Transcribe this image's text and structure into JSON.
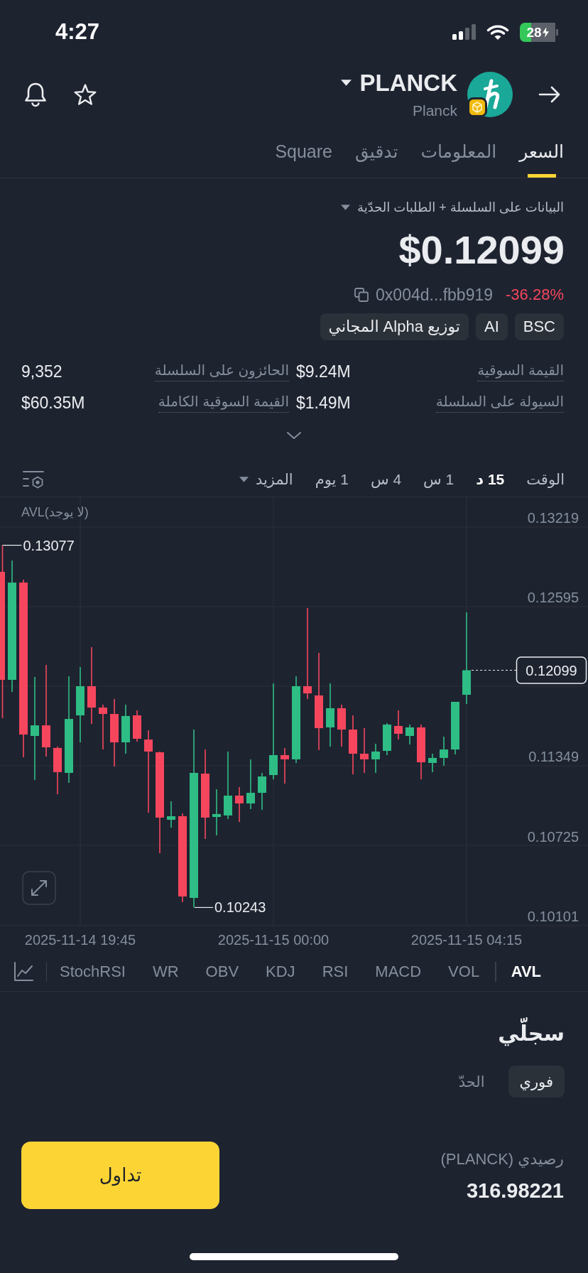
{
  "status_bar": {
    "time": "4:27",
    "battery": "28"
  },
  "header": {
    "symbol": "PLANCK",
    "name": "Planck"
  },
  "tabs": [
    {
      "label": "السعر",
      "selected": true
    },
    {
      "label": "المعلومات",
      "selected": false
    },
    {
      "label": "تدقيق",
      "selected": false
    },
    {
      "label": "Square",
      "selected": false
    }
  ],
  "data_source": "البيانات على السلسلة + الطلبات الحدّية",
  "price": "$0.12099",
  "contract_address": "0x004d...fbb919",
  "change": "-36.28%",
  "tags": [
    "BSC",
    "AI",
    "توزيع Alpha المجاني"
  ],
  "stats": [
    {
      "label": "القيمة السوقية",
      "value": "$9.24M"
    },
    {
      "label": "الحائزون على السلسلة",
      "value": "9,352"
    },
    {
      "label": "السيولة على السلسلة",
      "value": "$1.49M"
    },
    {
      "label": "القيمة السوقية الكاملة",
      "value": "$60.35M"
    }
  ],
  "chart_toolbar": {
    "label": "الوقت",
    "intervals": [
      {
        "label": "15 د",
        "selected": true
      },
      {
        "label": "1 س",
        "selected": false
      },
      {
        "label": "4 س",
        "selected": false
      },
      {
        "label": "1 يوم",
        "selected": false
      }
    ],
    "more": "المزيد"
  },
  "chart": {
    "indicator_label": "AVL(لا يوجد)",
    "high_label": "0.13077",
    "low_label": "0.10243",
    "last_price": "0.12099",
    "chart_data": {
      "type": "candlestick",
      "categories": [
        null,
        null,
        null,
        null,
        null,
        null,
        null,
        "2025-11-14 19:45",
        null,
        null,
        null,
        null,
        null,
        null,
        null,
        null,
        null,
        null,
        null,
        null,
        null,
        null,
        null,
        null,
        "2025-11-15 00:00",
        null,
        null,
        null,
        null,
        null,
        null,
        null,
        null,
        null,
        null,
        null,
        null,
        null,
        null,
        null,
        null,
        "2025-11-15 04:15"
      ],
      "ohlc": [
        [
          0.12869,
          0.13077,
          0.11724,
          0.12024
        ],
        [
          0.12024,
          0.12958,
          0.1193,
          0.12785
        ],
        [
          0.12785,
          0.12808,
          0.11418,
          0.11596
        ],
        [
          0.11585,
          0.12046,
          0.1124,
          0.11668
        ],
        [
          0.11668,
          0.12141,
          0.11424,
          0.11496
        ],
        [
          0.11491,
          0.11502,
          0.11129,
          0.11302
        ],
        [
          0.11296,
          0.12052,
          0.11218,
          0.11718
        ],
        [
          0.11746,
          0.12124,
          0.11535,
          0.11974
        ],
        [
          0.11974,
          0.1228,
          0.1168,
          0.11807
        ],
        [
          0.11807,
          0.1183,
          0.11479,
          0.11757
        ],
        [
          0.11757,
          0.11874,
          0.11346,
          0.11535
        ],
        [
          0.11535,
          0.1183,
          0.11446,
          0.11741
        ],
        [
          0.11746,
          0.11785,
          0.11541,
          0.11563
        ],
        [
          0.11557,
          0.11629,
          0.10985,
          0.11463
        ],
        [
          0.11457,
          0.11463,
          0.10668,
          0.10946
        ],
        [
          0.10929,
          0.11074,
          0.10868,
          0.10957
        ],
        [
          0.10957,
          0.10979,
          0.10284,
          0.10329
        ],
        [
          0.10318,
          0.11635,
          0.10243,
          0.11296
        ],
        [
          0.1129,
          0.11479,
          0.10779,
          0.10946
        ],
        [
          0.10951,
          0.11168,
          0.10807,
          0.10974
        ],
        [
          0.10963,
          0.11463,
          0.10935,
          0.11118
        ],
        [
          0.11118,
          0.11185,
          0.10913,
          0.11057
        ],
        [
          0.11057,
          0.11402,
          0.11013,
          0.1114
        ],
        [
          0.1114,
          0.11296,
          0.11007,
          0.11268
        ],
        [
          0.11279,
          0.11996,
          0.11246,
          0.11435
        ],
        [
          0.11435,
          0.11491,
          0.11213,
          0.11402
        ],
        [
          0.11402,
          0.12052,
          0.11374,
          0.11974
        ],
        [
          0.11974,
          0.12585,
          0.11874,
          0.11918
        ],
        [
          0.11902,
          0.12235,
          0.11474,
          0.11646
        ],
        [
          0.11652,
          0.11996,
          0.11502,
          0.11802
        ],
        [
          0.11802,
          0.1183,
          0.11502,
          0.11635
        ],
        [
          0.11635,
          0.11746,
          0.11285,
          0.11446
        ],
        [
          0.11446,
          0.11646,
          0.11296,
          0.11402
        ],
        [
          0.11402,
          0.11524,
          0.11296,
          0.11463
        ],
        [
          0.11468,
          0.11685,
          0.11435,
          0.11674
        ],
        [
          0.11663,
          0.11785,
          0.11557,
          0.11602
        ],
        [
          0.11585,
          0.11674,
          0.11518,
          0.11652
        ],
        [
          0.11652,
          0.11674,
          0.11246,
          0.11379
        ],
        [
          0.11374,
          0.11446,
          0.11302,
          0.11413
        ],
        [
          0.11413,
          0.11579,
          0.11352,
          0.11479
        ],
        [
          0.11479,
          0.11852,
          0.11441,
          0.11852
        ],
        [
          0.11907,
          0.12552,
          0.11835,
          0.12099
        ]
      ],
      "ylim": [
        0.10101,
        0.13219
      ],
      "yticks": [
        0.13219,
        0.12595,
        0.11349,
        0.10725,
        0.10101
      ],
      "grid": true
    }
  },
  "indicators": [
    {
      "label": "AVL",
      "selected": true
    },
    {
      "label": "VOL",
      "selected": false
    },
    {
      "label": "MACD",
      "selected": false
    },
    {
      "label": "RSI",
      "selected": false
    },
    {
      "label": "KDJ",
      "selected": false
    },
    {
      "label": "OBV",
      "selected": false
    },
    {
      "label": "WR",
      "selected": false
    },
    {
      "label": "StochRSI",
      "selected": false
    }
  ],
  "orders": {
    "title": "سجلّي",
    "order_types": [
      {
        "label": "فوري",
        "selected": true
      },
      {
        "label": "الحدّ",
        "selected": false
      }
    ],
    "balance_label": "رصيدي (PLANCK)",
    "balance": "316.98221",
    "trade_button": "تداول"
  }
}
